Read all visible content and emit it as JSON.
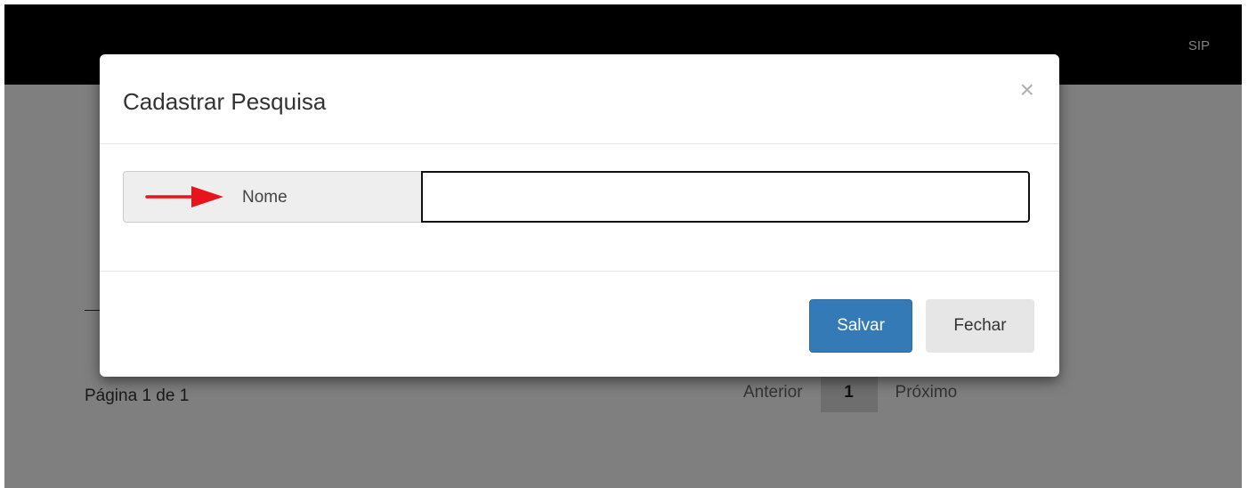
{
  "navbar": {
    "brand": "SIP"
  },
  "page": {
    "page_info": "Página 1 de 1",
    "pagination": {
      "previous": "Anterior",
      "current": "1",
      "next": "Próximo"
    }
  },
  "modal": {
    "title": "Cadastrar Pesquisa",
    "close_symbol": "×",
    "field": {
      "label": "Nome",
      "value": "",
      "placeholder": ""
    },
    "buttons": {
      "save": "Salvar",
      "close": "Fechar"
    }
  },
  "colors": {
    "primary": "#337ab7",
    "arrow": "#e8141b",
    "navbar": "#000000"
  }
}
